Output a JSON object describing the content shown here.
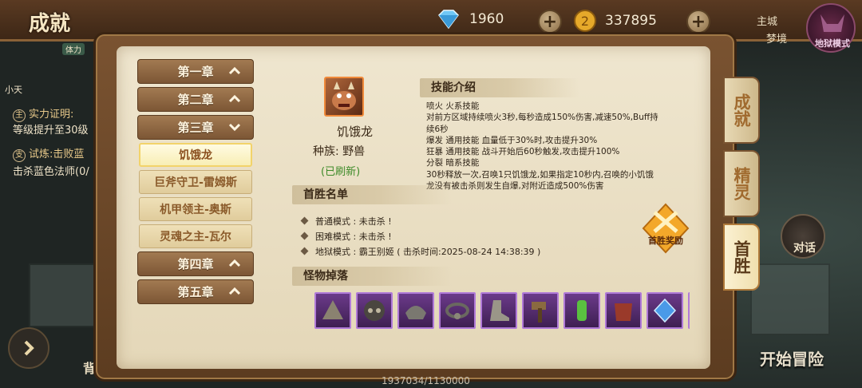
{
  "header": {
    "title": "成就",
    "gems": "1960",
    "gold": "337895"
  },
  "side_background": {
    "power_label": "体力",
    "line1": "小天",
    "quest1_tag": "主",
    "quest1_title": "实力证明:",
    "quest1_desc": "等级提升至30级",
    "quest2_tag": "支",
    "quest2_title": "试炼:击败蓝",
    "quest2_desc": "击杀蓝色法师(0/",
    "city": "主城",
    "mirror": "梦境",
    "hell_mode": "地狱模式",
    "chat": "对话",
    "back": "背",
    "start": "开始冒险"
  },
  "chapters": [
    {
      "label": "第一章",
      "state": "up"
    },
    {
      "label": "第二章",
      "state": "up"
    },
    {
      "label": "第三章",
      "state": "down"
    },
    {
      "label": "第四章",
      "state": "up"
    },
    {
      "label": "第五章",
      "state": "up"
    }
  ],
  "bosses": [
    {
      "label": "饥饿龙",
      "active": true
    },
    {
      "label": "巨斧守卫-雷姆斯",
      "active": false
    },
    {
      "label": "机甲领主-奥斯",
      "active": false
    },
    {
      "label": "灵魂之主-瓦尔",
      "active": false
    }
  ],
  "monster": {
    "name": "饥饿龙",
    "race": "种族:  野兽",
    "refresh": "(已刷新)"
  },
  "skills": {
    "header": "技能介绍",
    "lines": [
      "喷火  火系技能",
      "对前方区域持续喷火3秒,每秒造成150%伤害,减速50%,Buff持",
      "续6秒",
      "爆发  通用技能  血量低于30%时,攻击提升30%",
      "狂暴  通用技能  战斗开始后60秒触发,攻击提升100%",
      "分裂  暗系技能",
      "30秒释放一次,召唤1只饥饿龙,如果指定10秒内,召唤的小饥饿",
      "龙没有被击杀则发生自爆,对附近造成500%伤害"
    ]
  },
  "first_win": {
    "header": "首胜名单",
    "rows": [
      "普通模式 : 未击杀 !",
      "困难模式 : 未击杀 !",
      "地狱模式 : 霸王别姬 ( 击杀时间:2025-08-24 14:38:39 )"
    ],
    "reward_button": "首胜奖励"
  },
  "drops": {
    "header": "怪物掉落",
    "items": [
      "stone-shard-icon",
      "skull-helmet-icon",
      "pauldron-icon",
      "amulet-icon",
      "boot-icon",
      "hammer-icon",
      "green-potion-icon",
      "red-armor-icon",
      "blue-gem-icon",
      "partial-item-icon"
    ]
  },
  "tabs": [
    {
      "label": "成就",
      "active": false
    },
    {
      "label": "精灵",
      "active": false
    },
    {
      "label": "首胜",
      "active": true
    }
  ],
  "footer": {
    "exp": "1937034/1130000"
  },
  "colors": {
    "frame_wood": "#7a5331",
    "parchment": "#efe6cf",
    "chapter_button": "#a27a52",
    "active_boss_border": "#f2d36a",
    "refresh_green": "#3d8a28",
    "drop_slot": "#6b3a8a"
  }
}
